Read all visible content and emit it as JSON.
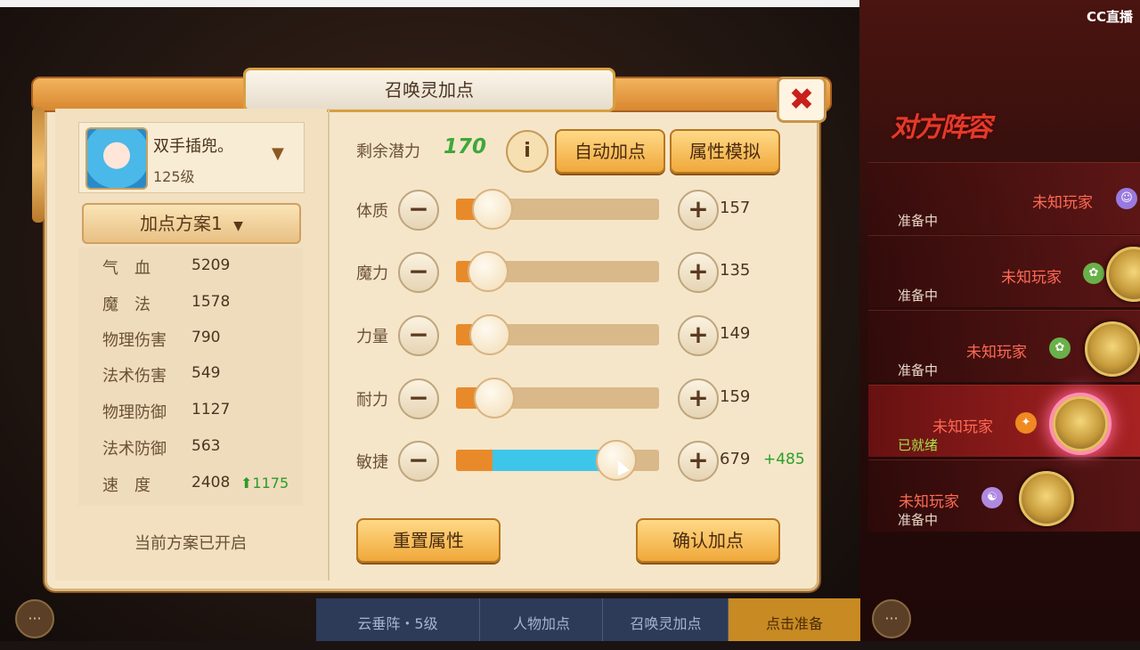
{
  "stream": {
    "logo": "CC直播"
  },
  "dialog": {
    "title": "召唤灵加点",
    "close_label": "✖",
    "pet": {
      "name": "双手插兜。",
      "level": "125级"
    },
    "plan_label": "加点方案1",
    "plan_chevron": "⌄",
    "stats": [
      {
        "label": "气　血",
        "value": "5209",
        "bonus": ""
      },
      {
        "label": "魔　法",
        "value": "1578",
        "bonus": ""
      },
      {
        "label": "物理伤害",
        "value": "790",
        "bonus": ""
      },
      {
        "label": "法术伤害",
        "value": "549",
        "bonus": ""
      },
      {
        "label": "物理防御",
        "value": "1127",
        "bonus": ""
      },
      {
        "label": "法术防御",
        "value": "563",
        "bonus": ""
      },
      {
        "label": "速　度",
        "value": "2408",
        "bonus": "⬆1175"
      }
    ],
    "plan_status": "当前方案已开启",
    "potential": {
      "label": "剩余潜力",
      "value": "170"
    },
    "info_label": "i",
    "auto_button": "自动加点",
    "simulate_button": "属性模拟",
    "minus_symbol": "−",
    "plus_symbol": "+",
    "attributes": [
      {
        "label": "体质",
        "value": "157",
        "added": "",
        "base_frac": 0.17,
        "add_frac": 0.0
      },
      {
        "label": "魔力",
        "value": "135",
        "added": "",
        "base_frac": 0.15,
        "add_frac": 0.0
      },
      {
        "label": "力量",
        "value": "149",
        "added": "",
        "base_frac": 0.16,
        "add_frac": 0.0
      },
      {
        "label": "耐力",
        "value": "159",
        "added": "",
        "base_frac": 0.18,
        "add_frac": 0.0
      },
      {
        "label": "敏捷",
        "value": "679",
        "added": "+485",
        "base_frac": 0.18,
        "add_frac": 0.6
      }
    ],
    "reset_button": "重置属性",
    "confirm_button": "确认加点"
  },
  "bottom_bar": {
    "tabs": [
      "云垂阵・5级",
      "人物加点",
      "召唤灵加点",
      "点击准备"
    ],
    "chat_icon": "···"
  },
  "opponents": {
    "title": "对方阵容",
    "players": [
      {
        "name": "未知玩家",
        "status": "准备中",
        "ready": false,
        "badge_color": "#9a7ae0"
      },
      {
        "name": "未知玩家",
        "status": "准备中",
        "ready": false,
        "badge_color": "#6ab04a"
      },
      {
        "name": "未知玩家",
        "status": "准备中",
        "ready": false,
        "badge_color": "#6ab04a"
      },
      {
        "name": "未知玩家",
        "status": "已就绪",
        "ready": true,
        "badge_color": "#f08a20"
      },
      {
        "name": "未知玩家",
        "status": "准备中",
        "ready": false,
        "badge_color": "#b08ae0"
      }
    ]
  }
}
